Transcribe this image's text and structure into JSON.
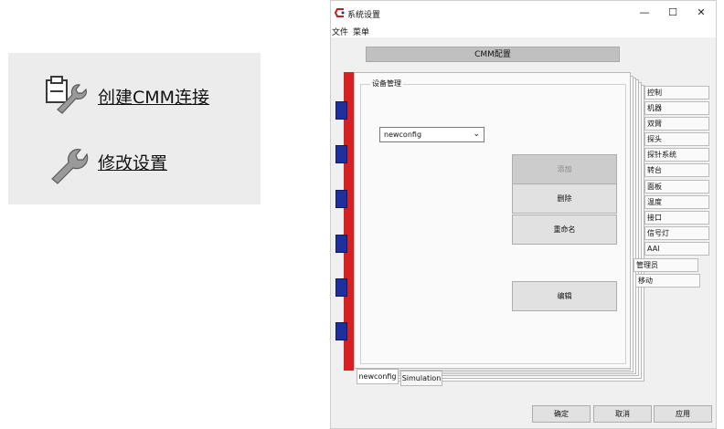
{
  "quick_links": {
    "create_label": "创建CMM连接",
    "modify_label": "修改设置"
  },
  "window": {
    "title": "系统设置",
    "controls": {
      "minimize": "—",
      "maximize": "☐",
      "close": "✕"
    },
    "menu": [
      "文件",
      "菜单"
    ]
  },
  "cmm_header": "CMM配置",
  "group": {
    "title": "设备管理",
    "select_value": "newconfig",
    "buttons": {
      "add": "添加",
      "delete": "删除",
      "rename": "重命名",
      "edit": "编辑"
    }
  },
  "right_tabs": [
    "控制",
    "机器",
    "双臂",
    "探头",
    "探针系统",
    "转台",
    "面板",
    "温度",
    "接口",
    "信号灯",
    "AAI"
  ],
  "right_tabs_lower": [
    "管理员",
    "移动"
  ],
  "bottom_tabs": [
    "newconfig",
    "Simulation"
  ],
  "dialog_buttons": {
    "ok": "确定",
    "cancel": "取消",
    "apply": "应用"
  },
  "colors": {
    "red_bar": "#d42222",
    "blue_tab": "#1f2f9e",
    "window_bg": "#f0f0f0"
  }
}
